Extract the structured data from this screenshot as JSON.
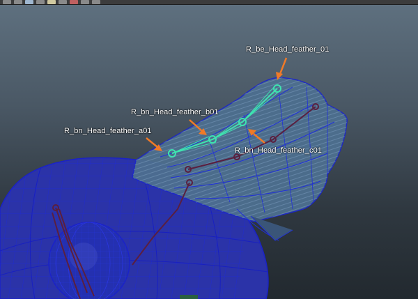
{
  "viewport": {
    "name": "3d-viewport"
  },
  "annotations": [
    {
      "id": "label_be_01",
      "text": "R_be_Head_feather_01"
    },
    {
      "id": "label_b01",
      "text": "R_bn_Head_feather_b01"
    },
    {
      "id": "label_a01",
      "text": "R_bn_Head_feather_a01"
    },
    {
      "id": "label_c01",
      "text": "R_bn_Head_feather_c01"
    }
  ],
  "colors": {
    "mesh_fill": "#2b33a8",
    "mesh_wire": "#1a22c8",
    "feather_fill": "#4d6f8f",
    "selected_joint": "#3fe3b0",
    "joint": "#5a1f3f",
    "arrow": "#f07a28"
  }
}
